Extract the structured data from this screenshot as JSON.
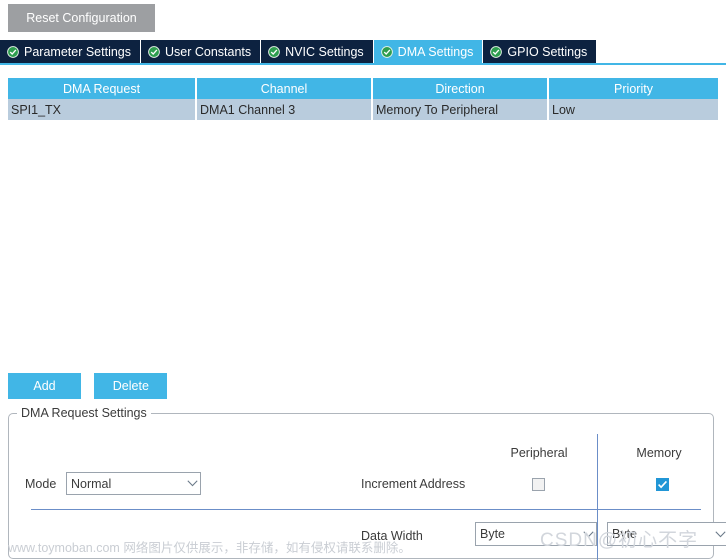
{
  "toolbar": {
    "reset_label": "Reset Configuration"
  },
  "tabs": [
    {
      "label": "Parameter Settings",
      "icon": "check-circle-icon",
      "active": false
    },
    {
      "label": "User Constants",
      "icon": "check-circle-icon",
      "active": false
    },
    {
      "label": "NVIC Settings",
      "icon": "check-circle-icon",
      "active": false
    },
    {
      "label": "DMA Settings",
      "icon": "check-circle-icon",
      "active": true
    },
    {
      "label": "GPIO Settings",
      "icon": "check-circle-icon",
      "active": false
    }
  ],
  "table": {
    "columns": [
      "DMA Request",
      "Channel",
      "Direction",
      "Priority"
    ],
    "rows": [
      {
        "selected": true,
        "cells": [
          "SPI1_TX",
          "DMA1 Channel 3",
          "Memory To Peripheral",
          "Low"
        ]
      }
    ]
  },
  "actions": {
    "add_label": "Add",
    "delete_label": "Delete"
  },
  "settings": {
    "group_title": "DMA Request Settings",
    "column_headers": {
      "peripheral": "Peripheral",
      "memory": "Memory"
    },
    "mode": {
      "label": "Mode",
      "value": "Normal"
    },
    "increment_address": {
      "label": "Increment Address",
      "peripheral_checked": false,
      "memory_checked": true
    },
    "data_width": {
      "label": "Data Width",
      "peripheral_value": "Byte",
      "memory_value": "Byte"
    }
  },
  "watermarks": {
    "left": "www.toymoban.com 网络图片仅供展示，非存储，如有侵权请联系删除。",
    "right": "CSDN@初心不字"
  },
  "colors": {
    "accent": "#41b6e6",
    "tab_inactive_bg": "#0d2240",
    "row_selected": "#b9ccdd",
    "reset_btn": "#9d9fa2",
    "checkbox_on": "#2196d6",
    "divider_blue": "#6b8ec8"
  }
}
